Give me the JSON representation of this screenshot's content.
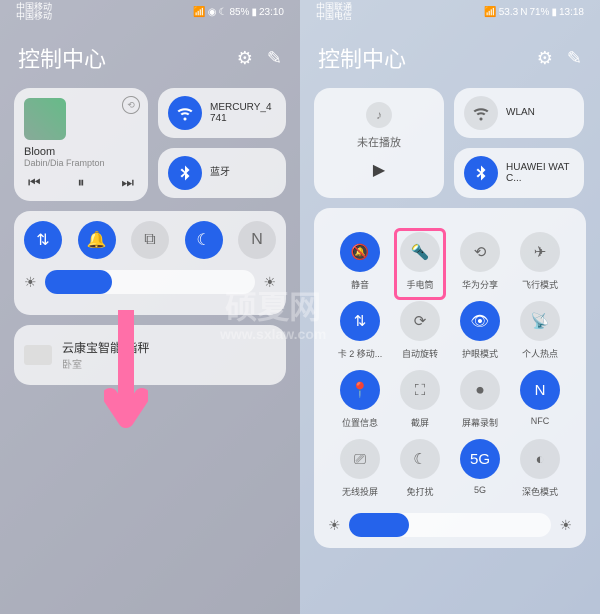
{
  "watermark": {
    "line1": "硕夏网",
    "line2": "www.sxlaw.com"
  },
  "left": {
    "status": {
      "carrier1": "中国移动",
      "carrier2": "中国移动",
      "battery": "85%",
      "time": "23:10"
    },
    "title": "控制中心",
    "music": {
      "title": "Bloom",
      "artist": "Dabin/Dia Frampton"
    },
    "wifi": "MERCURY_4741",
    "bt": "蓝牙",
    "device": {
      "name": "云康宝智能 指秤",
      "room": "卧室"
    },
    "slider": 32
  },
  "right": {
    "status": {
      "carrier1": "中国联通",
      "carrier2": "中国电信",
      "net": "53.3",
      "battery": "71%",
      "time": "13:18"
    },
    "title": "控制中心",
    "music": {
      "np": "未在播放"
    },
    "wifi": "WLAN",
    "bt": "HUAWEI WATC...",
    "grid": [
      {
        "n": "静音",
        "on": true,
        "ic": "bell"
      },
      {
        "n": "手电筒",
        "on": false,
        "ic": "torch",
        "hl": true
      },
      {
        "n": "华为分享",
        "on": false,
        "ic": "share"
      },
      {
        "n": "飞行模式",
        "on": false,
        "ic": "plane"
      },
      {
        "n": "卡 2 移动...",
        "on": true,
        "ic": "data"
      },
      {
        "n": "自动旋转",
        "on": false,
        "ic": "rotate"
      },
      {
        "n": "护眼模式",
        "on": true,
        "ic": "eye"
      },
      {
        "n": "个人热点",
        "on": false,
        "ic": "hotspot"
      },
      {
        "n": "位置信息",
        "on": true,
        "ic": "loc"
      },
      {
        "n": "截屏",
        "on": false,
        "ic": "shot"
      },
      {
        "n": "屏幕录制",
        "on": false,
        "ic": "rec"
      },
      {
        "n": "NFC",
        "on": true,
        "ic": "nfc"
      },
      {
        "n": "无线投屏",
        "on": false,
        "ic": "cast"
      },
      {
        "n": "免打扰",
        "on": false,
        "ic": "dnd"
      },
      {
        "n": "5G",
        "on": true,
        "ic": "5g"
      },
      {
        "n": "深色模式",
        "on": false,
        "ic": "dark"
      }
    ],
    "slider": 30
  }
}
